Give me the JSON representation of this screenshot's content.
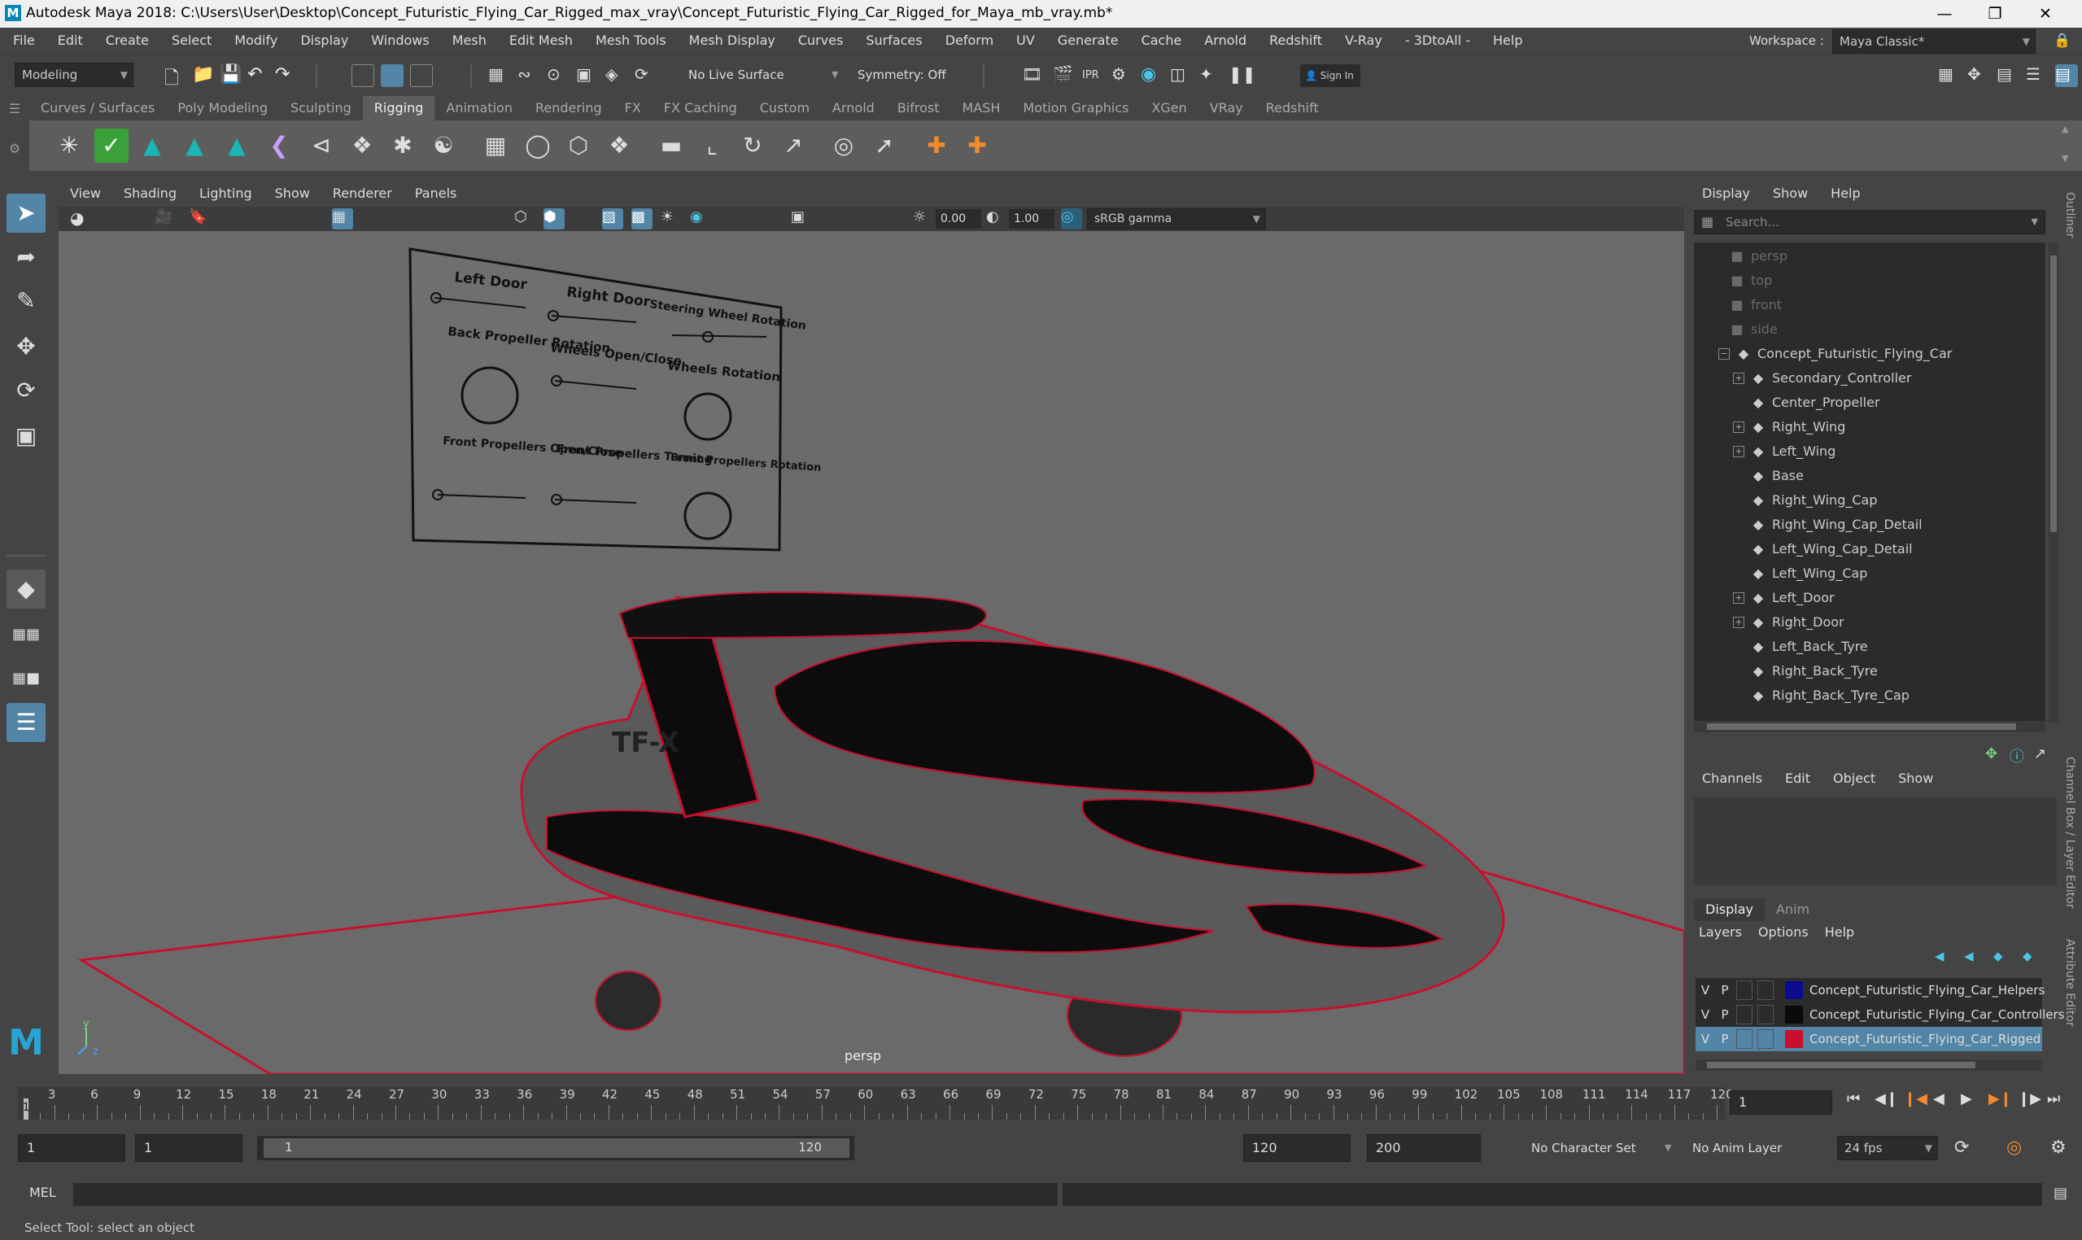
{
  "window": {
    "title": "Autodesk Maya 2018: C:\\Users\\User\\Desktop\\Concept_Futuristic_Flying_Car_Rigged_max_vray\\Concept_Futuristic_Flying_Car_Rigged_for_Maya_mb_vray.mb*",
    "logo": "M"
  },
  "menubar": {
    "items": [
      "File",
      "Edit",
      "Create",
      "Select",
      "Modify",
      "Display",
      "Windows",
      "Mesh",
      "Edit Mesh",
      "Mesh Tools",
      "Mesh Display",
      "Curves",
      "Surfaces",
      "Deform",
      "UV",
      "Generate",
      "Cache",
      "Arnold",
      "Redshift",
      "V-Ray",
      "- 3DtoAll -",
      "Help"
    ],
    "workspace_label": "Workspace :",
    "workspace_value": "Maya Classic*"
  },
  "statusline": {
    "mode": "Modeling",
    "live_surface": "No Live Surface",
    "symmetry": "Symmetry: Off",
    "sign_in": "Sign In"
  },
  "shelf": {
    "tabs": [
      "Curves / Surfaces",
      "Poly Modeling",
      "Sculpting",
      "Rigging",
      "Animation",
      "Rendering",
      "FX",
      "FX Caching",
      "Custom",
      "Arnold",
      "Bifrost",
      "MASH",
      "Motion Graphics",
      "XGen",
      "VRay",
      "Redshift"
    ],
    "active": "Rigging"
  },
  "viewport": {
    "menu": [
      "View",
      "Shading",
      "Lighting",
      "Show",
      "Renderer",
      "Panels"
    ],
    "exposure": "0.00",
    "gamma": "1.00",
    "color_space": "sRGB gamma",
    "camera_label": "persp",
    "control_board": {
      "labels": [
        "Left Door",
        "Right Door",
        "Steering Wheel Rotation",
        "Back Propeller Rotation",
        "Wheels Open/Close",
        "Wheels Rotation",
        "Front Propellers Open/Close",
        "Front Propellers Turning",
        "Front Propellers Rotation"
      ]
    },
    "car_text": "TF-X"
  },
  "outliner": {
    "menu": [
      "Display",
      "Show",
      "Help"
    ],
    "search_placeholder": "Search...",
    "cameras": [
      "persp",
      "top",
      "front",
      "side"
    ],
    "root": "Concept_Futuristic_Flying_Car",
    "children": [
      {
        "name": "Secondary_Controller",
        "expandable": true
      },
      {
        "name": "Center_Propeller",
        "expandable": false
      },
      {
        "name": "Right_Wing",
        "expandable": true
      },
      {
        "name": "Left_Wing",
        "expandable": true
      },
      {
        "name": "Base",
        "expandable": false
      },
      {
        "name": "Right_Wing_Cap",
        "expandable": false
      },
      {
        "name": "Right_Wing_Cap_Detail",
        "expandable": false
      },
      {
        "name": "Left_Wing_Cap_Detail",
        "expandable": false
      },
      {
        "name": "Left_Wing_Cap",
        "expandable": false
      },
      {
        "name": "Left_Door",
        "expandable": true
      },
      {
        "name": "Right_Door",
        "expandable": true
      },
      {
        "name": "Left_Back_Tyre",
        "expandable": false
      },
      {
        "name": "Right_Back_Tyre",
        "expandable": false
      },
      {
        "name": "Right_Back_Tyre_Cap",
        "expandable": false
      }
    ]
  },
  "channelbox": {
    "menu": [
      "Channels",
      "Edit",
      "Object",
      "Show"
    ]
  },
  "layers": {
    "tabs": [
      "Display",
      "Anim"
    ],
    "menu": [
      "Layers",
      "Options",
      "Help"
    ],
    "rows": [
      {
        "v": "V",
        "p": "P",
        "color": "#0b0b8f",
        "name": "Concept_Futuristic_Flying_Car_Helpers",
        "selected": false
      },
      {
        "v": "V",
        "p": "P",
        "color": "#0a0a0a",
        "name": "Concept_Futuristic_Flying_Car_Controllers",
        "selected": false
      },
      {
        "v": "V",
        "p": "P",
        "color": "#c8102e",
        "name": "Concept_Futuristic_Flying_Car_Rigged",
        "selected": true
      }
    ]
  },
  "side_tabs": [
    "Outliner",
    "Channel Box / Layer Editor",
    "Attribute Editor"
  ],
  "timeline": {
    "start": 1,
    "end": 120,
    "ticks": [
      3,
      6,
      9,
      12,
      15,
      18,
      21,
      24,
      27,
      30,
      33,
      36,
      39,
      42,
      45,
      48,
      51,
      54,
      57,
      60,
      63,
      66,
      69,
      72,
      75,
      78,
      81,
      84,
      87,
      90,
      93,
      96,
      99,
      102,
      105,
      108,
      111,
      114,
      117,
      120
    ],
    "current_frame": "1",
    "current_frame_marker": "1"
  },
  "range": {
    "start_field": "1",
    "playback_start": "1",
    "slider_start": "1",
    "slider_end": "120",
    "playback_end": "120",
    "end_field": "200",
    "character_set": "No Character Set",
    "anim_layer": "No Anim Layer",
    "fps": "24 fps"
  },
  "cmdline": {
    "label": "MEL"
  },
  "helpline": {
    "text": "Select Tool: select an object"
  }
}
